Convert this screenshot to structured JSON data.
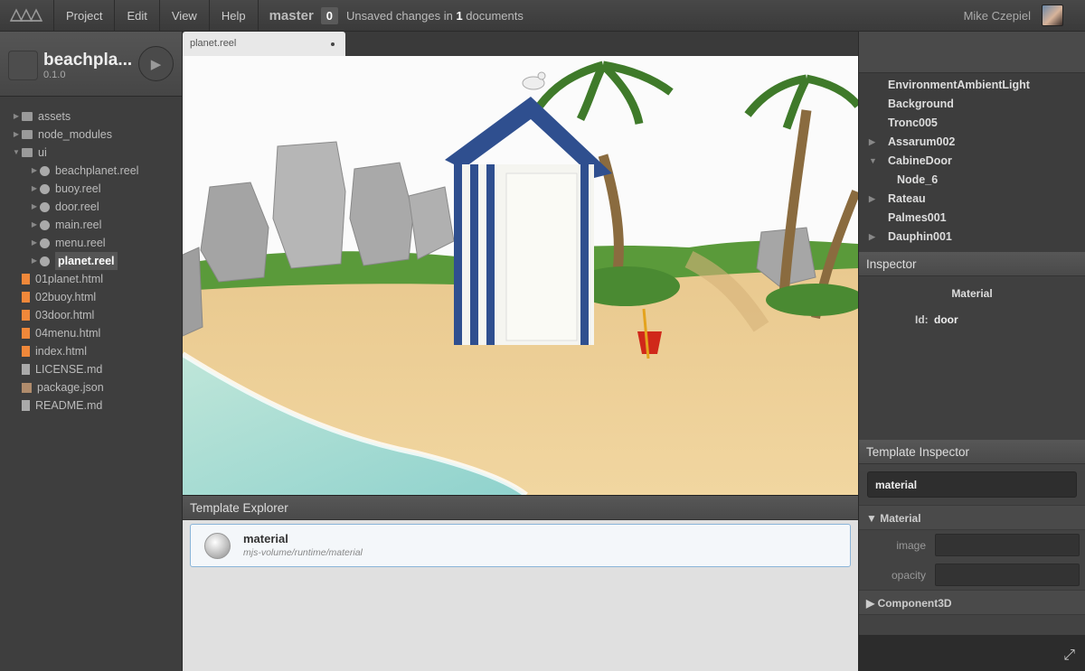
{
  "menubar": {
    "items": [
      "Project",
      "Edit",
      "View",
      "Help"
    ],
    "branch": "master",
    "unsaved_count": "0",
    "unsaved_prefix": "Unsaved changes in ",
    "unsaved_number": "1",
    "unsaved_suffix": " documents",
    "user_name": "Mike Czepiel"
  },
  "project": {
    "name": "beachpla...",
    "version": "0.1.0"
  },
  "filetree": [
    {
      "label": "assets",
      "type": "folder",
      "arrow": "▶",
      "depth": 0
    },
    {
      "label": "node_modules",
      "type": "folder",
      "arrow": "▶",
      "depth": 0
    },
    {
      "label": "ui",
      "type": "folder",
      "arrow": "▼",
      "depth": 0
    },
    {
      "label": "beachplanet.reel",
      "type": "reel",
      "arrow": "▶",
      "depth": 1
    },
    {
      "label": "buoy.reel",
      "type": "reel",
      "arrow": "▶",
      "depth": 1
    },
    {
      "label": "door.reel",
      "type": "reel",
      "arrow": "▶",
      "depth": 1
    },
    {
      "label": "main.reel",
      "type": "reel",
      "arrow": "▶",
      "depth": 1
    },
    {
      "label": "menu.reel",
      "type": "reel",
      "arrow": "▶",
      "depth": 1
    },
    {
      "label": "planet.reel",
      "type": "reel",
      "arrow": "▶",
      "depth": 1,
      "selected": true
    },
    {
      "label": "01planet.html",
      "type": "html",
      "arrow": "",
      "depth": 0
    },
    {
      "label": "02buoy.html",
      "type": "html",
      "arrow": "",
      "depth": 0
    },
    {
      "label": "03door.html",
      "type": "html",
      "arrow": "",
      "depth": 0
    },
    {
      "label": "04menu.html",
      "type": "html",
      "arrow": "",
      "depth": 0
    },
    {
      "label": "index.html",
      "type": "html",
      "arrow": "",
      "depth": 0
    },
    {
      "label": "LICENSE.md",
      "type": "md",
      "arrow": "",
      "depth": 0
    },
    {
      "label": "package.json",
      "type": "json",
      "arrow": "",
      "depth": 0
    },
    {
      "label": "README.md",
      "type": "md",
      "arrow": "",
      "depth": 0
    }
  ],
  "tab": {
    "label": "planet.reel"
  },
  "template_explorer": {
    "title": "Template Explorer",
    "item_name": "material",
    "item_path": "mjs-volume/runtime/material"
  },
  "scene_tree": [
    {
      "label": "EnvironmentAmbientLight",
      "arrow": "",
      "child": false
    },
    {
      "label": "Background",
      "arrow": "",
      "child": false
    },
    {
      "label": "Tronc005",
      "arrow": "",
      "child": false
    },
    {
      "label": "Assarum002",
      "arrow": "▶",
      "child": false
    },
    {
      "label": "CabineDoor",
      "arrow": "▼",
      "child": false
    },
    {
      "label": "Node_6",
      "arrow": "",
      "child": true
    },
    {
      "label": "Rateau",
      "arrow": "▶",
      "child": false
    },
    {
      "label": "Palmes001",
      "arrow": "",
      "child": false
    },
    {
      "label": "Dauphin001",
      "arrow": "▶",
      "child": false
    }
  ],
  "inspector": {
    "title": "Inspector",
    "object_type": "Material",
    "id_label": "Id:",
    "id_value": "door"
  },
  "template_inspector": {
    "title": "Template Inspector",
    "search_value": "material",
    "section_material": "▼ Material",
    "prop_image": "image",
    "prop_opacity": "opacity",
    "section_component": "▶ Component3D"
  },
  "colors": {
    "accent_border": "#8ab4d8",
    "html_file": "#f0883a",
    "hut_blue": "#2f4f8f"
  }
}
